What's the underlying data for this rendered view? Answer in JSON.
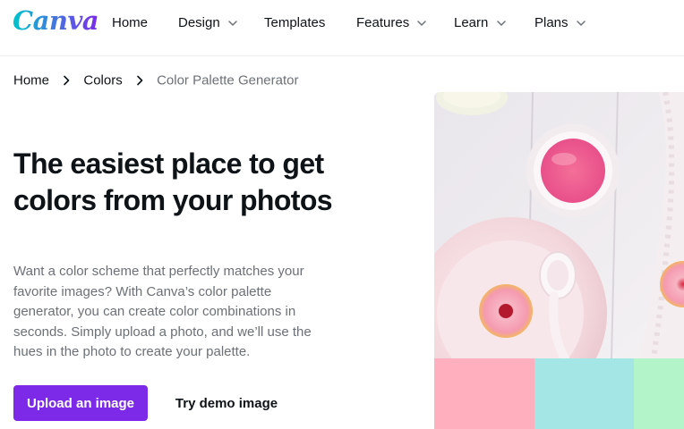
{
  "logo": {
    "text": "Canva"
  },
  "nav": {
    "items": [
      {
        "label": "Home",
        "has_dropdown": false
      },
      {
        "label": "Design",
        "has_dropdown": true
      },
      {
        "label": "Templates",
        "has_dropdown": false
      },
      {
        "label": "Features",
        "has_dropdown": true
      },
      {
        "label": "Learn",
        "has_dropdown": true
      },
      {
        "label": "Plans",
        "has_dropdown": true
      }
    ]
  },
  "breadcrumb": {
    "items": [
      "Home",
      "Colors",
      "Color Palette Generator"
    ]
  },
  "hero": {
    "title": "The easiest place to get colors from your photos",
    "description": "Want a color scheme that perfectly matches your favorite images? With Canva’s color palette generator, you can create color combinations in seconds. Simply upload a photo, and we’ll use the hues in the photo to create your palette.",
    "upload_button": "Upload an image",
    "demo_button": "Try demo image"
  },
  "palette": {
    "swatches": [
      "#ffafbd",
      "#a4e6e6",
      "#b3f5c8"
    ]
  },
  "colors": {
    "brand_purple": "#7d2ae8",
    "text": "#0e1318",
    "muted_text": "#6b7177"
  }
}
